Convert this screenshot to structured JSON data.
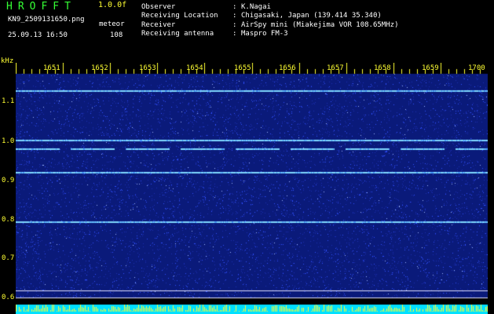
{
  "header": {
    "logo": "HROFFT",
    "version": "1.0.0f",
    "filename": "KN9_2509131650.png",
    "datetime": "25.09.13 16:50",
    "meteor_label": "meteor",
    "meteor_count": "108"
  },
  "meta": [
    {
      "key": "Observer",
      "value": "K.Nagai"
    },
    {
      "key": "Receiving Location",
      "value": "Chigasaki, Japan (139.414 35.340)"
    },
    {
      "key": "Receiver",
      "value": "AirSpy mini (Miakejima VOR 108.65MHz)"
    },
    {
      "key": "Receiving antenna",
      "value": "Maspro FM-3"
    }
  ],
  "axes": {
    "y_unit": "kHz",
    "y_ticks": [
      "1.1",
      "1.0",
      "0.9",
      "0.8",
      "0.7",
      "0.6"
    ],
    "x_ticks": [
      "1651",
      "1652",
      "1653",
      "1654",
      "1655",
      "1656",
      "1657",
      "1658",
      "1659",
      "1700"
    ]
  },
  "colors": {
    "background": "#000000",
    "waterfall": "#0a1a7a",
    "noise": "#3050ff",
    "signal": "#7fd8ff",
    "ticks": "#ffff33",
    "logo": "#35ff35"
  },
  "signal_lines_khz": [
    1.12,
    0.995,
    0.975,
    0.915,
    0.79
  ]
}
